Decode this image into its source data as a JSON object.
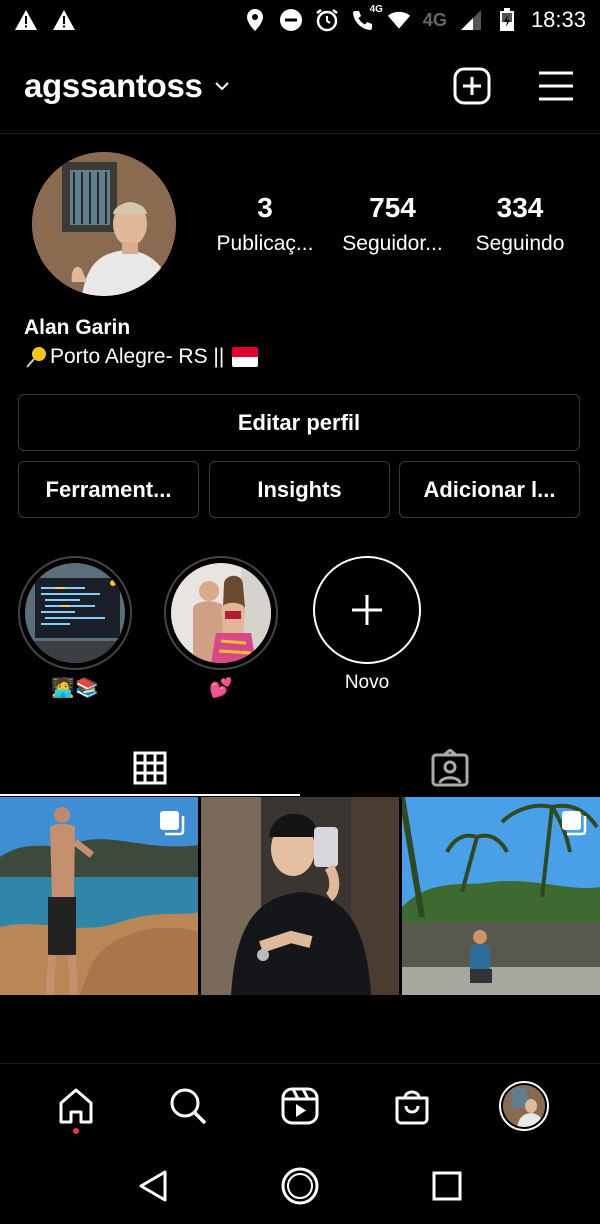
{
  "status_bar": {
    "time": "18:33",
    "network_label_1": "4G",
    "network_label_2": "4G"
  },
  "header": {
    "username": "agssantoss"
  },
  "profile": {
    "stats": [
      {
        "value": "3",
        "label": "Publicaç..."
      },
      {
        "value": "754",
        "label": "Seguidor..."
      },
      {
        "value": "334",
        "label": "Seguindo"
      }
    ],
    "name": "Alan Garin",
    "bio": "Porto Alegre- RS ||"
  },
  "buttons": {
    "edit_profile": "Editar perfil",
    "tools": "Ferrament...",
    "insights": "Insights",
    "add": "Adicionar l..."
  },
  "highlights": [
    {
      "label": "🧑‍💻📚"
    },
    {
      "label": "💕"
    },
    {
      "label": "Novo"
    }
  ],
  "tabs": [
    "grid",
    "tagged"
  ],
  "colors": {
    "background": "#000000",
    "border": "#3a3a3a",
    "notification_dot": "#ff3040"
  }
}
